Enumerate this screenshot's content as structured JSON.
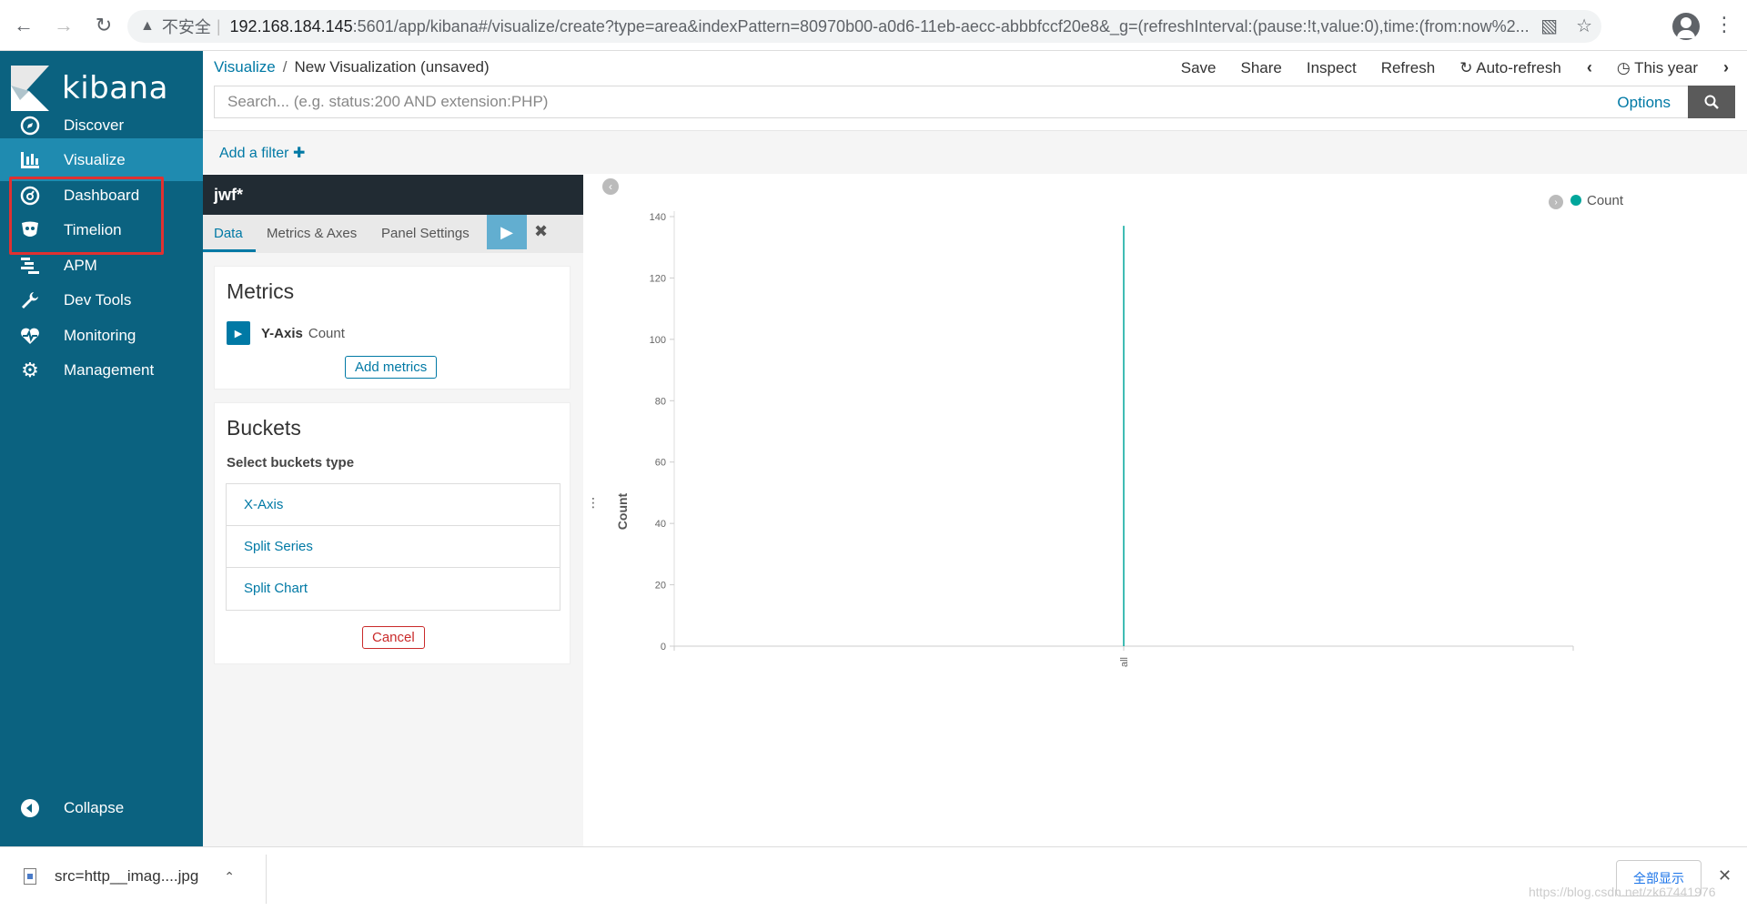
{
  "browser": {
    "insecure_label": "不安全",
    "url_host": "192.168.184.145",
    "url_rest": ":5601/app/kibana#/visualize/create?type=area&indexPattern=80970b00-a0d6-11eb-aecc-abbbfccf20e8&_g=(refreshInterval:(pause:!t,value:0),time:(from:now%2..."
  },
  "sidebar": {
    "logo_text": "kibana",
    "items": [
      {
        "label": "Discover",
        "icon": "compass-icon"
      },
      {
        "label": "Visualize",
        "icon": "bar-chart-icon"
      },
      {
        "label": "Dashboard",
        "icon": "dashboard-icon"
      },
      {
        "label": "Timelion",
        "icon": "timelion-icon"
      },
      {
        "label": "APM",
        "icon": "apm-icon"
      },
      {
        "label": "Dev Tools",
        "icon": "wrench-icon"
      },
      {
        "label": "Monitoring",
        "icon": "heartbeat-icon"
      },
      {
        "label": "Management",
        "icon": "gear-icon"
      }
    ],
    "collapse_label": "Collapse",
    "active_item": "Visualize"
  },
  "header": {
    "breadcrumb_parent": "Visualize",
    "breadcrumb_current": "New Visualization (unsaved)",
    "menu": {
      "save": "Save",
      "share": "Share",
      "inspect": "Inspect",
      "refresh": "Refresh",
      "auto_refresh": "Auto-refresh",
      "time": "This year"
    }
  },
  "search": {
    "placeholder": "Search... (e.g. status:200 AND extension:PHP)",
    "options_label": "Options"
  },
  "filter": {
    "add_label": "Add a filter"
  },
  "editor": {
    "index_pattern": "jwf*",
    "tabs": [
      "Data",
      "Metrics & Axes",
      "Panel Settings"
    ],
    "active_tab": "Data",
    "metrics": {
      "title": "Metrics",
      "axis_label": "Y-Axis",
      "axis_value": "Count",
      "add_button": "Add metrics"
    },
    "buckets": {
      "title": "Buckets",
      "subtitle": "Select buckets type",
      "options": [
        "X-Axis",
        "Split Series",
        "Split Chart"
      ],
      "cancel_button": "Cancel"
    }
  },
  "chart_data": {
    "type": "area",
    "ylabel": "Count",
    "xlabel": "",
    "x_tick_labels": [
      "all"
    ],
    "ylim": [
      0,
      140
    ],
    "yticks": [
      0,
      20,
      40,
      60,
      80,
      100,
      120,
      140
    ],
    "series": [
      {
        "name": "Count",
        "values": [
          137
        ]
      }
    ],
    "legend": [
      "Count"
    ],
    "legend_position": "top-right",
    "color": "#00a69b"
  },
  "downloads": {
    "filename": "src=http__imag....jpg",
    "show_all_label": "全部显示"
  },
  "watermark": "https://blog.csdn.net/zk67441976"
}
